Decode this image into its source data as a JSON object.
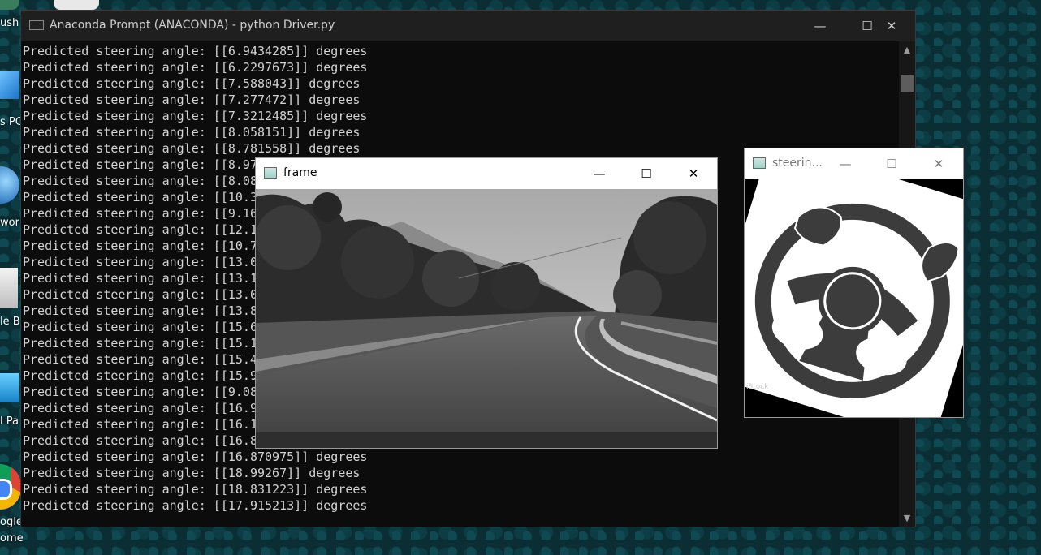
{
  "desktop": {
    "labels": [
      "ush",
      "s PC",
      "work",
      "le B",
      "l Pa",
      "ogle",
      "ome"
    ]
  },
  "console": {
    "title": "Anaconda Prompt (ANACONDA) - python  Driver.py",
    "minimize": "—",
    "maximize": "☐",
    "close": "✕",
    "lines": [
      "Predicted steering angle: [[6.9434285]] degrees",
      "Predicted steering angle: [[6.2297673]] degrees",
      "Predicted steering angle: [[7.588043]] degrees",
      "Predicted steering angle: [[7.277472]] degrees",
      "Predicted steering angle: [[7.3212485]] degrees",
      "Predicted steering angle: [[8.058151]] degrees",
      "Predicted steering angle: [[8.781558]] degrees",
      "Predicted steering angle: [[8.97",
      "Predicted steering angle: [[8.08",
      "Predicted steering angle: [[10.3",
      "Predicted steering angle: [[9.16",
      "Predicted steering angle: [[12.1",
      "Predicted steering angle: [[10.7",
      "Predicted steering angle: [[13.0",
      "Predicted steering angle: [[13.1",
      "Predicted steering angle: [[13.0",
      "Predicted steering angle: [[13.8",
      "Predicted steering angle: [[15.6",
      "Predicted steering angle: [[15.1",
      "Predicted steering angle: [[15.4",
      "Predicted steering angle: [[15.9",
      "Predicted steering angle: [[9.08",
      "Predicted steering angle: [[16.9",
      "Predicted steering angle: [[16.1",
      "Predicted steering angle: [[16.8",
      "Predicted steering angle: [[16.870975]] degrees",
      "Predicted steering angle: [[18.99267]] degrees",
      "Predicted steering angle: [[18.831223]] degrees",
      "Predicted steering angle: [[17.915213]] degrees"
    ]
  },
  "frame_window": {
    "title": "frame",
    "minimize": "—",
    "maximize": "☐",
    "close": "✕"
  },
  "steering_window": {
    "title": "steerin...",
    "minimize": "—",
    "maximize": "☐",
    "close": "✕",
    "watermark": "iStock"
  },
  "colors": {
    "console_bg": "#0c0c0c",
    "console_text": "#d4d4d4",
    "wheel_gray": "#3c3c3c"
  }
}
